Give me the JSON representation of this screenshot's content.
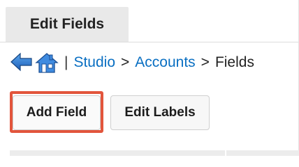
{
  "tab": {
    "title": "Edit Fields"
  },
  "breadcrumb": {
    "back_icon": "back-arrow-icon",
    "home_icon": "home-icon",
    "separator": "|",
    "items": [
      {
        "label": "Studio",
        "link": true
      },
      {
        "label": "Accounts",
        "link": true
      },
      {
        "label": "Fields",
        "link": false
      }
    ],
    "arrow": ">"
  },
  "toolbar": {
    "add_field_label": "Add Field",
    "edit_labels_label": "Edit Labels"
  },
  "colors": {
    "link": "#0a6fc2",
    "highlight": "#e2553c",
    "tab_bg": "#e9e9e9"
  }
}
